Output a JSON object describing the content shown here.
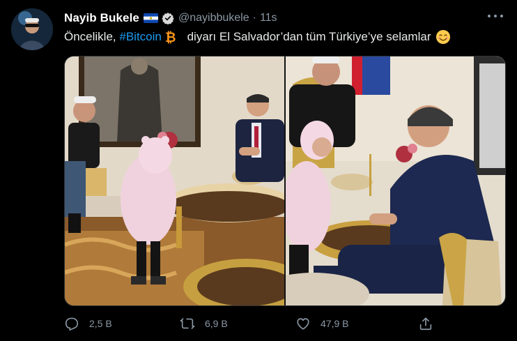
{
  "tweet": {
    "author_name": "Nayib Bukele",
    "handle": "@nayibbukele",
    "separator": "·",
    "time": "11s",
    "text_before": "Öncelikle, ",
    "hashtag": "#Bitcoin",
    "text_after": " diyarı El Salvador’dan tüm Türkiye’ye selamlar",
    "icons": {
      "flag": "el-salvador-flag-icon",
      "verified": "verified-badge-icon",
      "bitcoin": "bitcoin-icon",
      "emoji": "smiling-face-icon",
      "more": "more-options-icon"
    },
    "colors": {
      "accent": "#1d9bf0",
      "muted": "#8b98a5",
      "bitcoin": "#f7931a"
    }
  },
  "actions": {
    "reply_count": "2,5 B",
    "retweet_count": "6,9 B",
    "like_count": "47,9 B"
  }
}
